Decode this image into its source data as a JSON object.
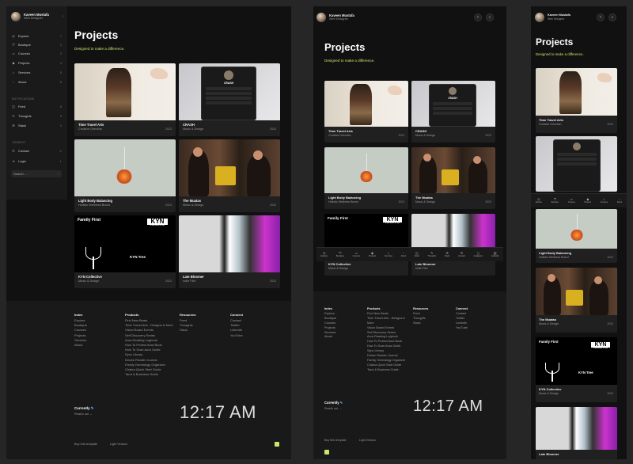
{
  "profile": {
    "name": "Kaveen Mustafa",
    "role": "Web Designer"
  },
  "sidebar": {
    "collapse_icon": "chevron-left-icon",
    "items": [
      {
        "label": "Explore",
        "icon": "explore-icon",
        "key": "1"
      },
      {
        "label": "Boutique",
        "icon": "boutique-icon",
        "key": "2"
      },
      {
        "label": "Courses",
        "icon": "courses-icon",
        "key": "3"
      },
      {
        "label": "Projects",
        "icon": "projects-icon",
        "key": "4"
      },
      {
        "label": "Services",
        "icon": "services-icon",
        "key": "5"
      },
      {
        "label": "About",
        "icon": "about-icon",
        "key": "6"
      }
    ],
    "section_notifications": "NOTIFICATIONS",
    "notif_items": [
      {
        "label": "Feed",
        "icon": "feed-icon",
        "key": "8"
      },
      {
        "label": "Thoughts",
        "icon": "thoughts-icon",
        "key": "9"
      },
      {
        "label": "Stack",
        "icon": "stack-icon",
        "key": "0"
      }
    ],
    "section_connect": "CONNECT",
    "connect_items": [
      {
        "label": "Contact",
        "icon": "contact-icon",
        "key": "C"
      },
      {
        "label": "Login",
        "icon": "login-icon",
        "key": "L"
      }
    ],
    "search": {
      "label": "Search ...",
      "key": "/"
    }
  },
  "page": {
    "title": "Projects",
    "subtitle": "Designed to make a difference."
  },
  "projects": [
    {
      "name": "Time Travel Arts",
      "category": "Creative Direction",
      "year": "2023",
      "image": "painting"
    },
    {
      "name": "CRASH",
      "category": "Music & Design",
      "year": "2023",
      "image": "app",
      "app_title": "CRASH"
    },
    {
      "name": "Light Body Balancing",
      "category": "Holistic Wellness Brand",
      "year": "2023",
      "image": "sand"
    },
    {
      "name": "The Muatas",
      "category": "Music & Design",
      "year": "2023",
      "image": "photo"
    },
    {
      "name": "KYN Collective",
      "category": "Music & Design",
      "year": "2023",
      "image": "kyn",
      "poster_title": "Family First",
      "logo": "KYN",
      "logo_sub": "COLLECTIVE",
      "tree_text": "KYN Tree"
    },
    {
      "name": "Late Bloomer",
      "category": "Indie Film",
      "year": "2023",
      "image": "film"
    }
  ],
  "footer": {
    "cols": [
      {
        "head": "Index",
        "links": [
          "Explore",
          "Boutique",
          "Courses",
          "Projects",
          "Services",
          "About"
        ]
      },
      {
        "head": "Products",
        "links": [
          "Find New Beats",
          "Time Travel Arts - Designs & More",
          "Vision Board Events",
          "Self Discovery Series",
          "Aura Reading Logbook",
          "How To Protect Aura Book",
          "How To Scan Aura Guide",
          "Sync Library",
          "Dream Reader Journal",
          "Family Genealogy Organizer",
          "Chakra Quick Start Guide",
          "Tarot & Business Guide"
        ]
      },
      {
        "head": "Resources",
        "links": [
          "Feed",
          "Thoughts",
          "Stack"
        ]
      },
      {
        "head": "Connect",
        "links": [
          "Contact",
          "Twitter",
          "LinkedIn",
          "YouTube"
        ]
      }
    ],
    "currently": "Currently",
    "currently_icon": "pen-icon",
    "readout": "Read's out →",
    "clock": "12:17 AM",
    "buy_template": "Buy this template",
    "light_version": "Light Version"
  },
  "topbar": {
    "plus_icon": "plus-icon",
    "search_icon": "search-icon"
  },
  "dock": [
    {
      "label": "Explore",
      "icon": "explore-icon",
      "glyph": "◎"
    },
    {
      "label": "Boutique",
      "icon": "boutique-icon",
      "glyph": "⛉"
    },
    {
      "label": "Courses",
      "icon": "courses-icon",
      "glyph": "▱"
    },
    {
      "label": "Projects",
      "icon": "projects-icon",
      "glyph": "◆"
    },
    {
      "label": "Services",
      "icon": "services-icon",
      "glyph": "⌂"
    },
    {
      "label": "About",
      "icon": "about-icon",
      "glyph": "◌"
    },
    {
      "label": "Feed",
      "icon": "feed-icon",
      "glyph": "◫"
    },
    {
      "label": "Thoughts",
      "icon": "thoughts-icon",
      "glyph": "✎"
    },
    {
      "label": "Stack",
      "icon": "stack-icon",
      "glyph": "⚙"
    },
    {
      "label": "Contact",
      "icon": "contact-icon",
      "glyph": "✆"
    },
    {
      "label": "Instagram",
      "icon": "instagram-icon",
      "glyph": "◻"
    },
    {
      "label": "LinkedIn",
      "icon": "linkedin-icon",
      "glyph": "▥"
    }
  ],
  "colors": {
    "accent": "#c9e86a",
    "background": "#111111",
    "panel": "#1a1a1a"
  }
}
